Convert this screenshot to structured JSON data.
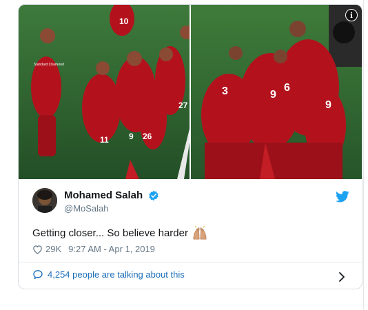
{
  "tweet": {
    "display_name": "Mohamed Salah",
    "handle": "@MoSalah",
    "text": "Getting closer... So believe harder",
    "likes": "29K",
    "timestamp": "9:27 AM - Apr 1, 2019",
    "talking": "4,254 people are talking about this"
  },
  "media": {
    "info_label": "i",
    "left_photo": {
      "jersey_numbers": [
        "10",
        "11",
        "9",
        "26",
        "27"
      ],
      "sponsor": "Standard Chartered"
    },
    "right_photo": {
      "jersey_numbers": [
        "3",
        "9",
        "6",
        "9"
      ]
    }
  },
  "icons": {
    "verified": "verified-badge-icon",
    "bird": "twitter-bird-icon",
    "heart": "heart-icon",
    "bubble": "speech-bubble-icon",
    "chevron": "chevron-right-icon",
    "emoji": "raising-hands-emoji"
  },
  "colors": {
    "twitter_blue": "#1da1f2",
    "link_blue": "#1b6eb8",
    "liverpool_red": "#b3121d",
    "pitch_green": "#2f6b35"
  }
}
